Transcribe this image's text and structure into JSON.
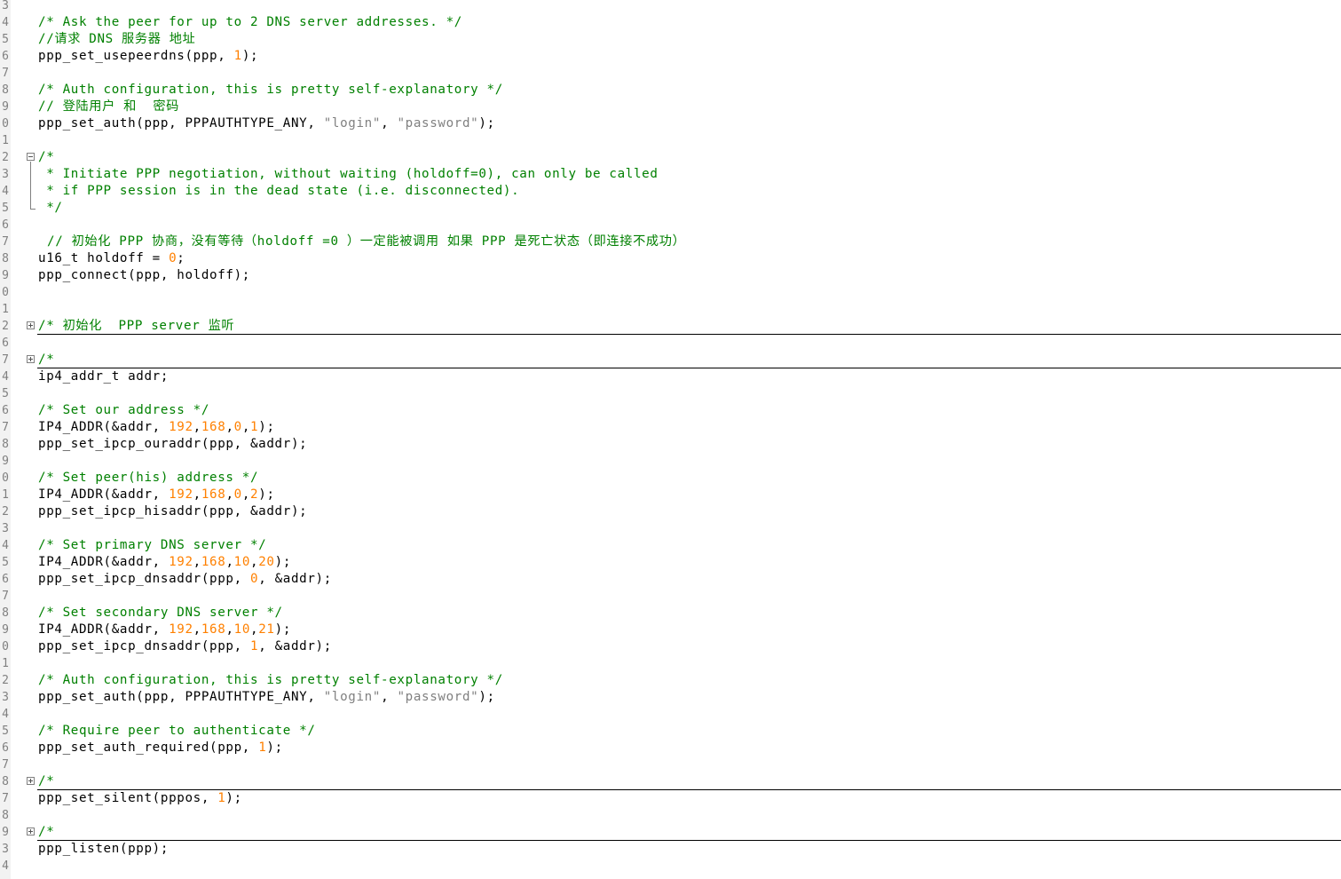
{
  "editor": {
    "lines": [
      {
        "n": "3",
        "y": 0,
        "tokens": []
      },
      {
        "n": "4",
        "tokens": [
          {
            "c": "comment",
            "t": "/* Ask the peer for up to 2 DNS server addresses. */"
          }
        ]
      },
      {
        "n": "5",
        "tokens": [
          {
            "c": "comment",
            "t": "//请求 DNS 服务器 地址"
          }
        ]
      },
      {
        "n": "6",
        "tokens": [
          {
            "c": "plain",
            "t": "ppp_set_usepeerdns(ppp, "
          },
          {
            "c": "number",
            "t": "1"
          },
          {
            "c": "plain",
            "t": ");"
          }
        ]
      },
      {
        "n": "7",
        "tokens": []
      },
      {
        "n": "8",
        "tokens": [
          {
            "c": "comment",
            "t": "/* Auth configuration, this is pretty self-explanatory */"
          }
        ]
      },
      {
        "n": "9",
        "tokens": [
          {
            "c": "comment",
            "t": "// 登陆用户 和  密码"
          }
        ]
      },
      {
        "n": "0",
        "tokens": [
          {
            "c": "plain",
            "t": "ppp_set_auth(ppp, PPPAUTHTYPE_ANY, "
          },
          {
            "c": "string",
            "t": "\"login\""
          },
          {
            "c": "plain",
            "t": ", "
          },
          {
            "c": "string",
            "t": "\"password\""
          },
          {
            "c": "plain",
            "t": ");"
          }
        ]
      },
      {
        "n": "1",
        "tokens": []
      },
      {
        "n": "2",
        "fold": "minus",
        "tokens": [
          {
            "c": "comment",
            "t": "/*"
          }
        ]
      },
      {
        "n": "3",
        "tokens": [
          {
            "c": "comment",
            "t": " * Initiate PPP negotiation, without waiting (holdoff=0), can only be called"
          }
        ]
      },
      {
        "n": "4",
        "tokens": [
          {
            "c": "comment",
            "t": " * if PPP session is in the dead state (i.e. disconnected)."
          }
        ]
      },
      {
        "n": "5",
        "fold": "end",
        "tokens": [
          {
            "c": "comment",
            "t": " */"
          }
        ]
      },
      {
        "n": "6",
        "tokens": []
      },
      {
        "n": "7",
        "indent": true,
        "tokens": [
          {
            "c": "comment",
            "t": "// 初始化 PPP 协商，没有等待（holdoff =0 ）一定能被调用 如果 PPP 是死亡状态（即连接不成功）"
          }
        ]
      },
      {
        "n": "8",
        "tokens": [
          {
            "c": "plain",
            "t": "u16_t holdoff = "
          },
          {
            "c": "number",
            "t": "0"
          },
          {
            "c": "plain",
            "t": ";"
          }
        ]
      },
      {
        "n": "9",
        "tokens": [
          {
            "c": "plain",
            "t": "ppp_connect(ppp, holdoff);"
          }
        ]
      },
      {
        "n": "0",
        "tokens": []
      },
      {
        "n": "1",
        "tokens": []
      },
      {
        "n": "2",
        "fold": "plus",
        "tokens": [
          {
            "c": "comment",
            "t": "/* 初始化  PPP server 监听"
          }
        ]
      },
      {
        "n": "6",
        "tokens": []
      },
      {
        "n": "7",
        "fold": "plus",
        "tokens": [
          {
            "c": "comment",
            "t": "/*"
          }
        ]
      },
      {
        "n": "4",
        "tokens": [
          {
            "c": "plain",
            "t": "ip4_addr_t addr;"
          }
        ]
      },
      {
        "n": "5",
        "tokens": []
      },
      {
        "n": "6",
        "tokens": [
          {
            "c": "comment",
            "t": "/* Set our address */"
          }
        ]
      },
      {
        "n": "7",
        "tokens": [
          {
            "c": "plain",
            "t": "IP4_ADDR(&addr, "
          },
          {
            "c": "number",
            "t": "192"
          },
          {
            "c": "plain",
            "t": ","
          },
          {
            "c": "number",
            "t": "168"
          },
          {
            "c": "plain",
            "t": ","
          },
          {
            "c": "number",
            "t": "0"
          },
          {
            "c": "plain",
            "t": ","
          },
          {
            "c": "number",
            "t": "1"
          },
          {
            "c": "plain",
            "t": ");"
          }
        ]
      },
      {
        "n": "8",
        "tokens": [
          {
            "c": "plain",
            "t": "ppp_set_ipcp_ouraddr(ppp, &addr);"
          }
        ]
      },
      {
        "n": "9",
        "tokens": []
      },
      {
        "n": "0",
        "tokens": [
          {
            "c": "comment",
            "t": "/* Set peer(his) address */"
          }
        ]
      },
      {
        "n": "1",
        "tokens": [
          {
            "c": "plain",
            "t": "IP4_ADDR(&addr, "
          },
          {
            "c": "number",
            "t": "192"
          },
          {
            "c": "plain",
            "t": ","
          },
          {
            "c": "number",
            "t": "168"
          },
          {
            "c": "plain",
            "t": ","
          },
          {
            "c": "number",
            "t": "0"
          },
          {
            "c": "plain",
            "t": ","
          },
          {
            "c": "number",
            "t": "2"
          },
          {
            "c": "plain",
            "t": ");"
          }
        ]
      },
      {
        "n": "2",
        "tokens": [
          {
            "c": "plain",
            "t": "ppp_set_ipcp_hisaddr(ppp, &addr);"
          }
        ]
      },
      {
        "n": "3",
        "tokens": []
      },
      {
        "n": "4",
        "tokens": [
          {
            "c": "comment",
            "t": "/* Set primary DNS server */"
          }
        ]
      },
      {
        "n": "5",
        "tokens": [
          {
            "c": "plain",
            "t": "IP4_ADDR(&addr, "
          },
          {
            "c": "number",
            "t": "192"
          },
          {
            "c": "plain",
            "t": ","
          },
          {
            "c": "number",
            "t": "168"
          },
          {
            "c": "plain",
            "t": ","
          },
          {
            "c": "number",
            "t": "10"
          },
          {
            "c": "plain",
            "t": ","
          },
          {
            "c": "number",
            "t": "20"
          },
          {
            "c": "plain",
            "t": ");"
          }
        ]
      },
      {
        "n": "6",
        "tokens": [
          {
            "c": "plain",
            "t": "ppp_set_ipcp_dnsaddr(ppp, "
          },
          {
            "c": "number",
            "t": "0"
          },
          {
            "c": "plain",
            "t": ", &addr);"
          }
        ]
      },
      {
        "n": "7",
        "tokens": []
      },
      {
        "n": "8",
        "tokens": [
          {
            "c": "comment",
            "t": "/* Set secondary DNS server */"
          }
        ]
      },
      {
        "n": "9",
        "tokens": [
          {
            "c": "plain",
            "t": "IP4_ADDR(&addr, "
          },
          {
            "c": "number",
            "t": "192"
          },
          {
            "c": "plain",
            "t": ","
          },
          {
            "c": "number",
            "t": "168"
          },
          {
            "c": "plain",
            "t": ","
          },
          {
            "c": "number",
            "t": "10"
          },
          {
            "c": "plain",
            "t": ","
          },
          {
            "c": "number",
            "t": "21"
          },
          {
            "c": "plain",
            "t": ");"
          }
        ]
      },
      {
        "n": "0",
        "tokens": [
          {
            "c": "plain",
            "t": "ppp_set_ipcp_dnsaddr(ppp, "
          },
          {
            "c": "number",
            "t": "1"
          },
          {
            "c": "plain",
            "t": ", &addr);"
          }
        ]
      },
      {
        "n": "1",
        "tokens": []
      },
      {
        "n": "2",
        "tokens": [
          {
            "c": "comment",
            "t": "/* Auth configuration, this is pretty self-explanatory */"
          }
        ]
      },
      {
        "n": "3",
        "tokens": [
          {
            "c": "plain",
            "t": "ppp_set_auth(ppp, PPPAUTHTYPE_ANY, "
          },
          {
            "c": "string",
            "t": "\"login\""
          },
          {
            "c": "plain",
            "t": ", "
          },
          {
            "c": "string",
            "t": "\"password\""
          },
          {
            "c": "plain",
            "t": ");"
          }
        ]
      },
      {
        "n": "4",
        "tokens": []
      },
      {
        "n": "5",
        "tokens": [
          {
            "c": "comment",
            "t": "/* Require peer to authenticate */"
          }
        ]
      },
      {
        "n": "6",
        "tokens": [
          {
            "c": "plain",
            "t": "ppp_set_auth_required(ppp, "
          },
          {
            "c": "number",
            "t": "1"
          },
          {
            "c": "plain",
            "t": ");"
          }
        ]
      },
      {
        "n": "7",
        "tokens": []
      },
      {
        "n": "8",
        "fold": "plus",
        "tokens": [
          {
            "c": "comment",
            "t": "/*"
          }
        ]
      },
      {
        "n": "7",
        "tokens": [
          {
            "c": "plain",
            "t": "ppp_set_silent(pppos, "
          },
          {
            "c": "number",
            "t": "1"
          },
          {
            "c": "plain",
            "t": ");"
          }
        ]
      },
      {
        "n": "8",
        "tokens": []
      },
      {
        "n": "9",
        "fold": "plus",
        "tokens": [
          {
            "c": "comment",
            "t": "/*"
          }
        ]
      },
      {
        "n": "3",
        "tokens": [
          {
            "c": "plain",
            "t": "ppp_listen(ppp);"
          }
        ]
      },
      {
        "n": "4",
        "tokens": []
      }
    ]
  },
  "colors": {
    "comment": "#008000",
    "number": "#ff8000",
    "string": "#808080",
    "plain": "#000000"
  }
}
